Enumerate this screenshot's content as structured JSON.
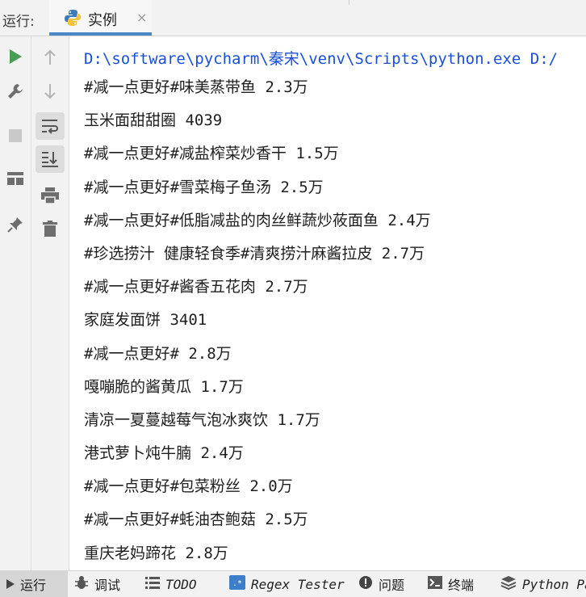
{
  "header": {
    "run_title": "运行:",
    "tab_label": "实例",
    "tab_close": "×"
  },
  "console": {
    "path": "D:\\software\\pycharm\\秦宋\\venv\\Scripts\\python.exe D:/",
    "lines": [
      "#减一点更好#味美蒸带鱼 2.3万",
      "玉米面甜甜圈 4039",
      "#减一点更好#减盐榨菜炒香干 1.5万",
      "#减一点更好#雪菜梅子鱼汤 2.5万",
      "#减一点更好#低脂减盐的肉丝鲜蔬炒莜面鱼 2.4万",
      "#珍选捞汁 健康轻食季#清爽捞汁麻酱拉皮 2.7万",
      "#减一点更好#酱香五花肉 2.7万",
      "家庭发面饼 3401",
      "#减一点更好# 2.8万",
      "嘎嘣脆的酱黄瓜 1.7万",
      "清凉一夏蔓越莓气泡冰爽饮 1.7万",
      "港式萝卜炖牛腩 2.4万",
      "#减一点更好#包菜粉丝 2.0万",
      "#减一点更好#蚝油杏鲍菇 2.5万",
      "重庆老妈蹄花 2.8万"
    ]
  },
  "bottom_bar": {
    "run": "运行",
    "debug": "调试",
    "todo": "TODO",
    "regex": "Regex Tester",
    "problems": "问题",
    "terminal": "终端",
    "python": "Python Pa"
  },
  "colors": {
    "accent": "#4a88c7",
    "run_green": "#499c54",
    "path_blue": "#1a4fd8"
  }
}
